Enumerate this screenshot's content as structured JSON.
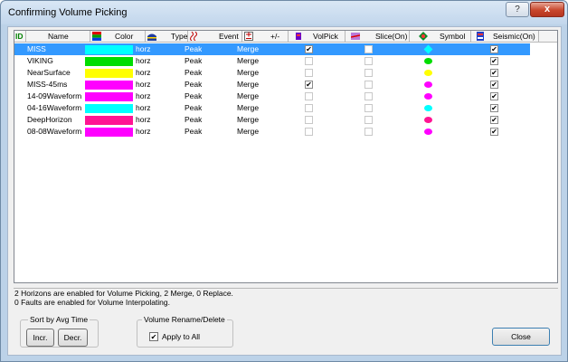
{
  "window": {
    "title": "Confirming Volume Picking",
    "help_glyph": "?",
    "close_glyph": "x"
  },
  "columns": [
    {
      "key": "id",
      "label": "ID"
    },
    {
      "key": "name",
      "label": "Name"
    },
    {
      "key": "color",
      "label": "Color",
      "icon": "color-palette-icon"
    },
    {
      "key": "type",
      "label": "Type",
      "icon": "horizon-type-icon"
    },
    {
      "key": "event",
      "label": "Event",
      "icon": "event-wave-icon"
    },
    {
      "key": "plusminus",
      "label": "+/-",
      "icon": "plus-minus-icon"
    },
    {
      "key": "volpick",
      "label": "VolPick",
      "icon": "volume-pick-icon"
    },
    {
      "key": "slice",
      "label": "Slice(On)",
      "icon": "slice-icon"
    },
    {
      "key": "symbol",
      "label": "Symbol",
      "icon": "symbol-icon"
    },
    {
      "key": "seismic",
      "label": "Seismic(On)",
      "icon": "seismic-icon"
    }
  ],
  "rows": [
    {
      "name": "MISS",
      "color": "#00ffff",
      "type": "horz",
      "event": "Peak",
      "plusminus": "Merge",
      "volpick": true,
      "slice": false,
      "symbol_color": "#00ffff",
      "symbol_shape": "diamond",
      "seismic": true,
      "selected": true
    },
    {
      "name": "VIKING",
      "color": "#00dd00",
      "type": "horz",
      "event": "Peak",
      "plusminus": "Merge",
      "volpick": false,
      "slice": false,
      "symbol_color": "#00dd00",
      "symbol_shape": "ellipse",
      "seismic": true,
      "selected": false
    },
    {
      "name": "NearSurface",
      "color": "#ffff00",
      "type": "horz",
      "event": "Peak",
      "plusminus": "Merge",
      "volpick": false,
      "slice": false,
      "symbol_color": "#ffff00",
      "symbol_shape": "ellipse",
      "seismic": true,
      "selected": false
    },
    {
      "name": "MISS-45ms",
      "color": "#ff00ff",
      "type": "horz",
      "event": "Peak",
      "plusminus": "Merge",
      "volpick": true,
      "slice": false,
      "symbol_color": "#ff00ff",
      "symbol_shape": "ellipse",
      "seismic": true,
      "selected": false
    },
    {
      "name": "14-09Waveform",
      "color": "#ff00ff",
      "type": "horz",
      "event": "Peak",
      "plusminus": "Merge",
      "volpick": false,
      "slice": false,
      "symbol_color": "#ff00ff",
      "symbol_shape": "ellipse",
      "seismic": true,
      "selected": false
    },
    {
      "name": "04-16Waveform",
      "color": "#00ffff",
      "type": "horz",
      "event": "Peak",
      "plusminus": "Merge",
      "volpick": false,
      "slice": false,
      "symbol_color": "#00ffff",
      "symbol_shape": "ellipse",
      "seismic": true,
      "selected": false
    },
    {
      "name": "DeepHorizon",
      "color": "#ff1493",
      "type": "horz",
      "event": "Peak",
      "plusminus": "Merge",
      "volpick": false,
      "slice": false,
      "symbol_color": "#ff1493",
      "symbol_shape": "ellipse",
      "seismic": true,
      "selected": false
    },
    {
      "name": "08-08Waveform",
      "color": "#ff00ff",
      "type": "horz",
      "event": "Peak",
      "plusminus": "Merge",
      "volpick": false,
      "slice": false,
      "symbol_color": "#ff00ff",
      "symbol_shape": "ellipse",
      "seismic": true,
      "selected": false
    }
  ],
  "status": {
    "line1": "2 Horizons are enabled for Volume Picking, 2 Merge, 0 Replace.",
    "line2": "0 Faults are enabled for Volume Interpolating."
  },
  "sort": {
    "group_label": "Sort by Avg Time",
    "incr_label": "Incr.",
    "decr_label": "Decr."
  },
  "rename": {
    "group_label": "Volume Rename/Delete",
    "apply_label": "Apply to All",
    "apply_checked": true
  },
  "footer": {
    "close_label": "Close"
  },
  "check_glyph": "✔"
}
